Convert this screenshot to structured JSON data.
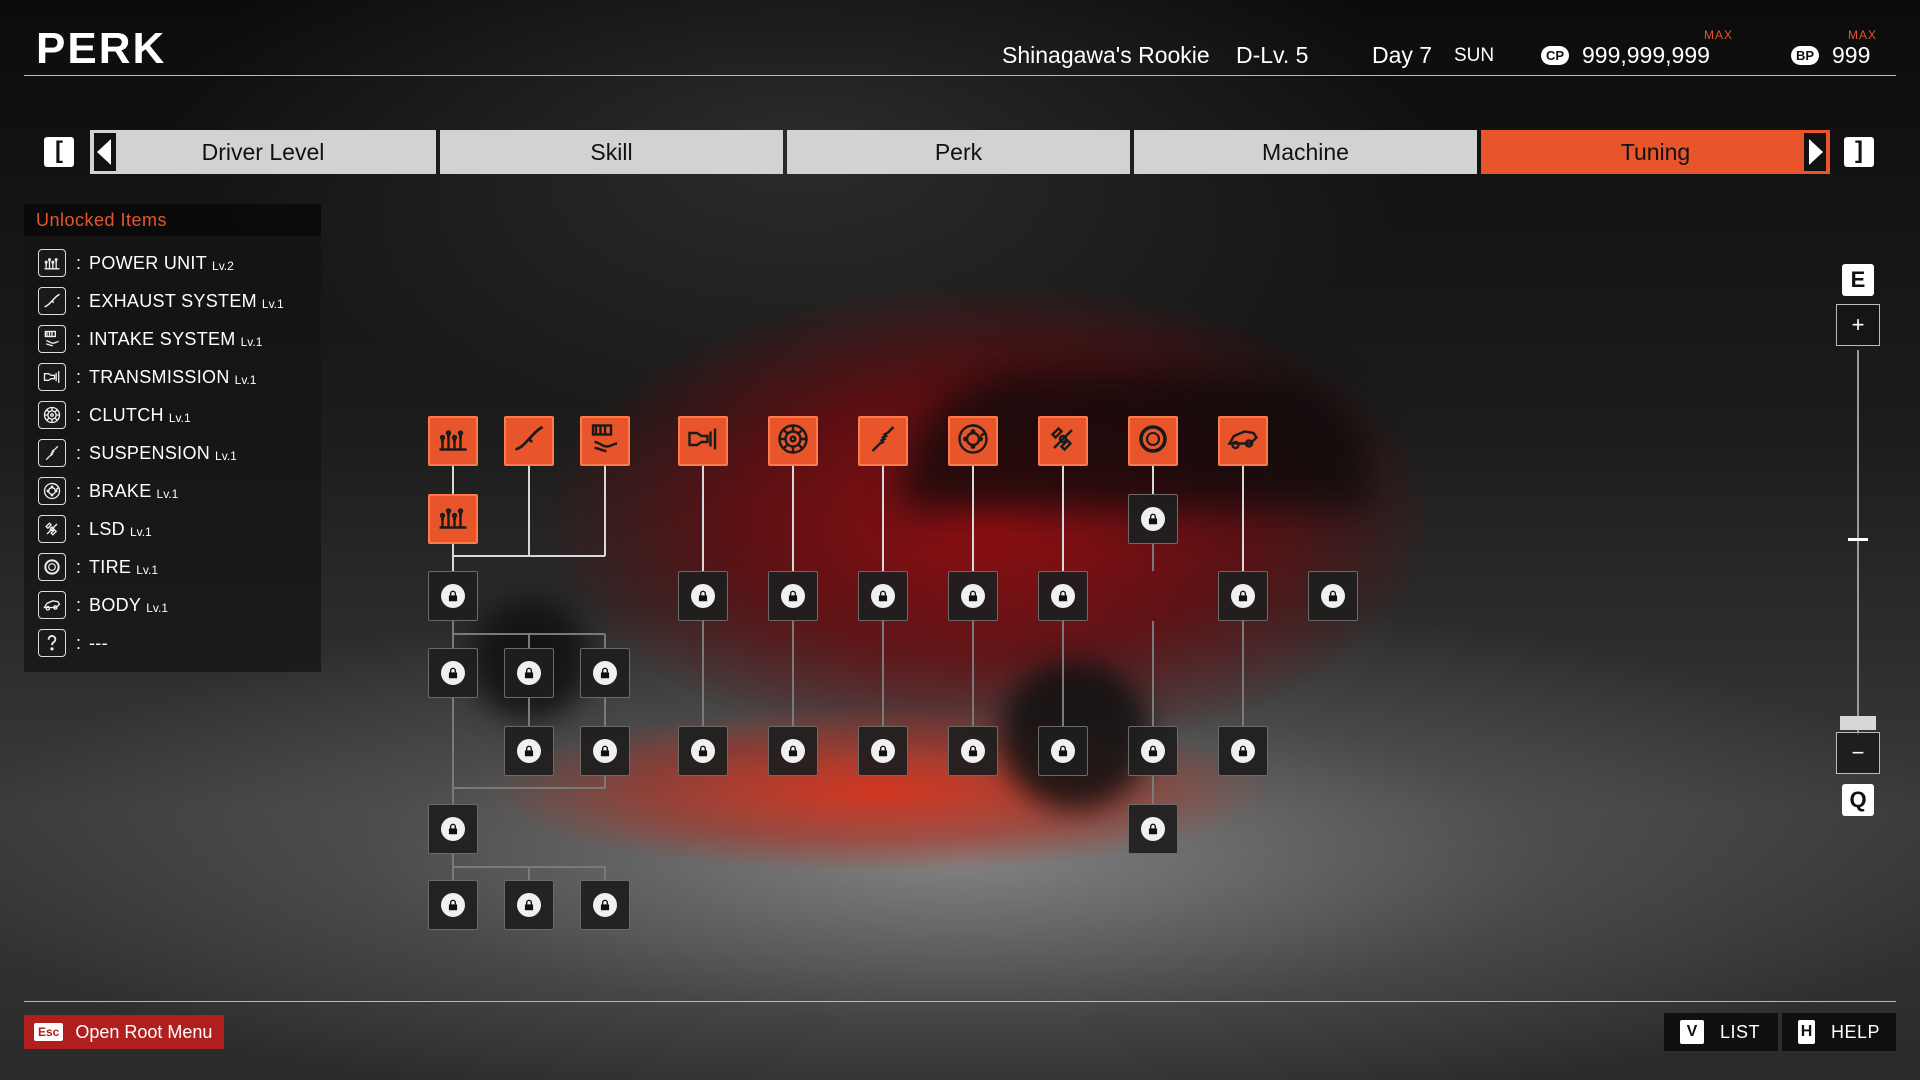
{
  "header": {
    "title": "PERK",
    "driver_title": "Shinagawa's Rookie",
    "driver_level": "D-Lv. 5",
    "day": "Day 7",
    "weekday": "SUN",
    "cp_badge": "CP",
    "cp_value": "999,999,999",
    "cp_max": "MAX",
    "bp_badge": "BP",
    "bp_value": "999",
    "bp_max": "MAX"
  },
  "tabs": {
    "prev_key": "[",
    "next_key": "]",
    "items": [
      {
        "label": "Driver Level",
        "active": false
      },
      {
        "label": "Skill",
        "active": false
      },
      {
        "label": "Perk",
        "active": false
      },
      {
        "label": "Machine",
        "active": false
      },
      {
        "label": "Tuning",
        "active": true
      }
    ]
  },
  "unlocked_items": {
    "title": "Unlocked Items",
    "items": [
      {
        "icon": "power-unit-icon",
        "name": "POWER UNIT",
        "level": "Lv.2"
      },
      {
        "icon": "exhaust-icon",
        "name": "EXHAUST SYSTEM",
        "level": "Lv.1"
      },
      {
        "icon": "intake-icon",
        "name": "INTAKE SYSTEM",
        "level": "Lv.1"
      },
      {
        "icon": "transmission-icon",
        "name": "TRANSMISSION",
        "level": "Lv.1"
      },
      {
        "icon": "clutch-icon",
        "name": "CLUTCH",
        "level": "Lv.1"
      },
      {
        "icon": "suspension-icon",
        "name": "SUSPENSION",
        "level": "Lv.1"
      },
      {
        "icon": "brake-icon",
        "name": "BRAKE",
        "level": "Lv.1"
      },
      {
        "icon": "lsd-icon",
        "name": "LSD",
        "level": "Lv.1"
      },
      {
        "icon": "tire-icon",
        "name": "TIRE",
        "level": "Lv.1"
      },
      {
        "icon": "body-icon",
        "name": "BODY",
        "level": "Lv.1"
      },
      {
        "icon": "question-icon",
        "name": "---",
        "level": ""
      }
    ]
  },
  "tree": {
    "unlocked_nodes": [
      "power-unit",
      "exhaust",
      "intake",
      "transmission",
      "clutch",
      "suspension",
      "brake",
      "lsd",
      "tire",
      "body",
      "power-unit-2"
    ],
    "locked_node_count": 32
  },
  "zoom": {
    "zoom_in_key": "E",
    "zoom_out_key": "Q",
    "plus": "+",
    "minus": "−",
    "level": 0.0
  },
  "footer": {
    "esc_key": "Esc",
    "esc_label": "Open Root Menu",
    "list_key": "V",
    "list_label": "LIST",
    "help_key": "H",
    "help_label": "HELP"
  },
  "colors": {
    "accent": "#e8552a",
    "esc_red": "#b01e1e"
  }
}
